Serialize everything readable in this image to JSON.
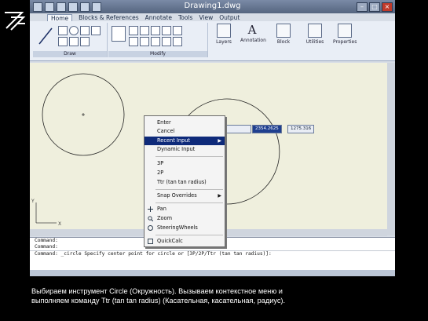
{
  "window": {
    "title": "Drawing1.dwg"
  },
  "tabs": [
    "Home",
    "Blocks & References",
    "Annotate",
    "Tools",
    "View",
    "Output"
  ],
  "ribbon": {
    "panels": [
      "Draw",
      "Modify"
    ],
    "buttons": [
      "Layers",
      "Annotation",
      "Block",
      "Utilities",
      "Properties"
    ]
  },
  "dynamic_input": {
    "values": [
      "2354.2625",
      "1275.316"
    ]
  },
  "context_menu": {
    "items": [
      "Enter",
      "Cancel",
      "Recent Input",
      "Dynamic Input",
      "3P",
      "2P",
      "Ttr (tan tan radius)",
      "Snap Overrides",
      "Pan",
      "Zoom",
      "SteeringWheels",
      "QuickCalc"
    ],
    "highlighted": "Recent Input"
  },
  "command_line": {
    "lines": [
      "Command:",
      "Command:",
      "Command: _circle Specify center point for circle or [3P/2P/Ttr (tan tan radius)]:"
    ]
  },
  "caption": {
    "line1": "Выбираем инструмент Circle (Окружность). Вызываем контекстное меню и",
    "line2": "выполняем команду Ttr (tan tan radius) (Касательная, касательная, радиус)."
  },
  "colors": {
    "canvas": "#efefdd",
    "menu_highlight": "#0e2a7a",
    "background": "#000000"
  }
}
